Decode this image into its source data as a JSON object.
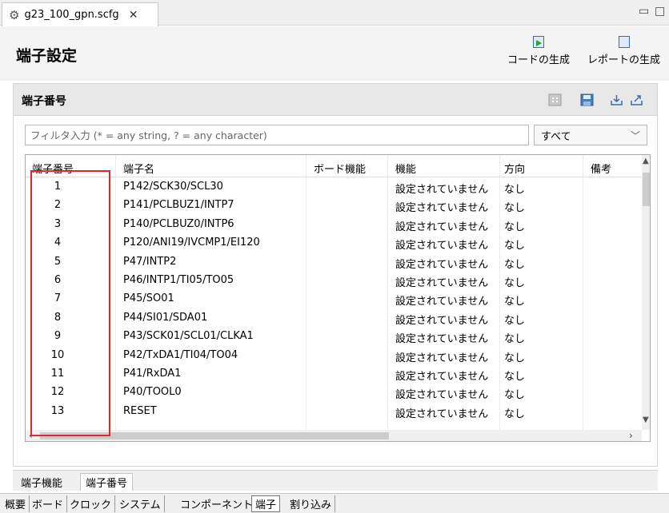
{
  "editor_tab": {
    "label": "g23_100_gpn.scfg",
    "close": "✕"
  },
  "window_controls": {
    "minimize": "▭",
    "maximize": "□"
  },
  "header": {
    "title": "端子設定",
    "code_gen_label": "コードの生成",
    "report_gen_label": "レポートの生成"
  },
  "panel": {
    "title": "端子番号",
    "filter_placeholder": "フィルタ入力 (* = any string, ? = any character)",
    "filter_select_value": "すべて"
  },
  "table": {
    "columns": [
      "端子番号",
      "端子名",
      "ボード機能",
      "機能",
      "方向",
      "備考"
    ],
    "rows": [
      {
        "no": "1",
        "name": "P142/SCK30/SCL30",
        "board": "",
        "func": "設定されていません",
        "dir": "なし",
        "note": ""
      },
      {
        "no": "2",
        "name": "P141/PCLBUZ1/INTP7",
        "board": "",
        "func": "設定されていません",
        "dir": "なし",
        "note": ""
      },
      {
        "no": "3",
        "name": "P140/PCLBUZ0/INTP6",
        "board": "",
        "func": "設定されていません",
        "dir": "なし",
        "note": ""
      },
      {
        "no": "4",
        "name": "P120/ANI19/IVCMP1/EI120",
        "board": "",
        "func": "設定されていません",
        "dir": "なし",
        "note": ""
      },
      {
        "no": "5",
        "name": "P47/INTP2",
        "board": "",
        "func": "設定されていません",
        "dir": "なし",
        "note": ""
      },
      {
        "no": "6",
        "name": "P46/INTP1/TI05/TO05",
        "board": "",
        "func": "設定されていません",
        "dir": "なし",
        "note": ""
      },
      {
        "no": "7",
        "name": "P45/SO01",
        "board": "",
        "func": "設定されていません",
        "dir": "なし",
        "note": ""
      },
      {
        "no": "8",
        "name": "P44/SI01/SDA01",
        "board": "",
        "func": "設定されていません",
        "dir": "なし",
        "note": ""
      },
      {
        "no": "9",
        "name": "P43/SCK01/SCL01/CLKA1",
        "board": "",
        "func": "設定されていません",
        "dir": "なし",
        "note": ""
      },
      {
        "no": "10",
        "name": "P42/TxDA1/TI04/TO04",
        "board": "",
        "func": "設定されていません",
        "dir": "なし",
        "note": ""
      },
      {
        "no": "11",
        "name": "P41/RxDA1",
        "board": "",
        "func": "設定されていません",
        "dir": "なし",
        "note": ""
      },
      {
        "no": "12",
        "name": "P40/TOOL0",
        "board": "",
        "func": "設定されていません",
        "dir": "なし",
        "note": ""
      },
      {
        "no": "13",
        "name": "RESET",
        "board": "",
        "func": "設定されていません",
        "dir": "なし",
        "note": ""
      }
    ]
  },
  "sub_tabs": [
    "端子機能",
    "端子番号"
  ],
  "bottom_tabs": [
    "概要",
    "ボード",
    "クロック",
    "システム",
    "コンポーネント",
    "端子",
    "割り込み"
  ],
  "colors": {
    "highlight_border": "#e3262d",
    "header_bg": "#f4f4f4",
    "accent_blue": "#3a6ea5"
  }
}
